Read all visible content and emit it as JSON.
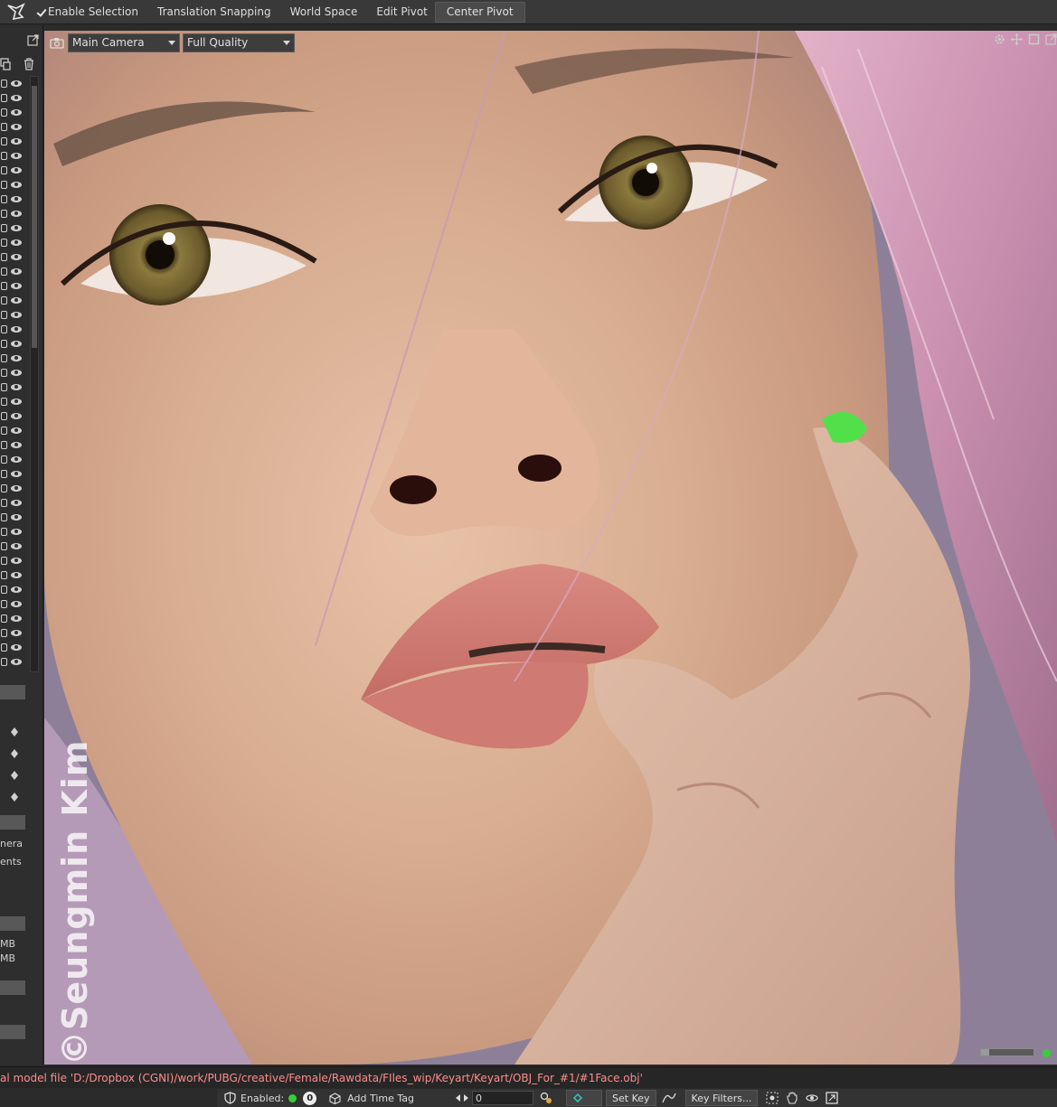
{
  "toolbar": {
    "enable_selection": "Enable Selection",
    "translation_snapping": "Translation Snapping",
    "world_space": "World Space",
    "edit_pivot": "Edit Pivot",
    "center_pivot": "Center Pivot",
    "enable_selection_checked": true,
    "translation_snapping_checked": false,
    "world_space_checked": false,
    "edit_pivot_checked": false
  },
  "viewport": {
    "camera_select": "Main Camera",
    "quality_select": "Full Quality",
    "watermark": "©Seungmin Kim",
    "progress": 0.15,
    "status_color": "#34d034"
  },
  "left_panel": {
    "text_1": "nera",
    "text_2": "ents",
    "text_3": "MB",
    "text_4": "MB"
  },
  "status_bar": {
    "message": "al model file 'D:/Dropbox (CGNI)/work/PUBG/creative/Female/Rawdata/FIles_wip/Keyart/Keyart/OBJ_For_#1/#1Face.obj'"
  },
  "bottom_bar": {
    "enabled_label": "Enabled:",
    "enabled_count": "0",
    "add_time_tag": "Add Time Tag",
    "time_value": "0",
    "set_key": "Set Key",
    "key_filters": "Key Filters..."
  },
  "colors": {
    "toolbar_bg": "#393939",
    "status_message": "#ff8c8c",
    "accent_green": "#34d034"
  }
}
